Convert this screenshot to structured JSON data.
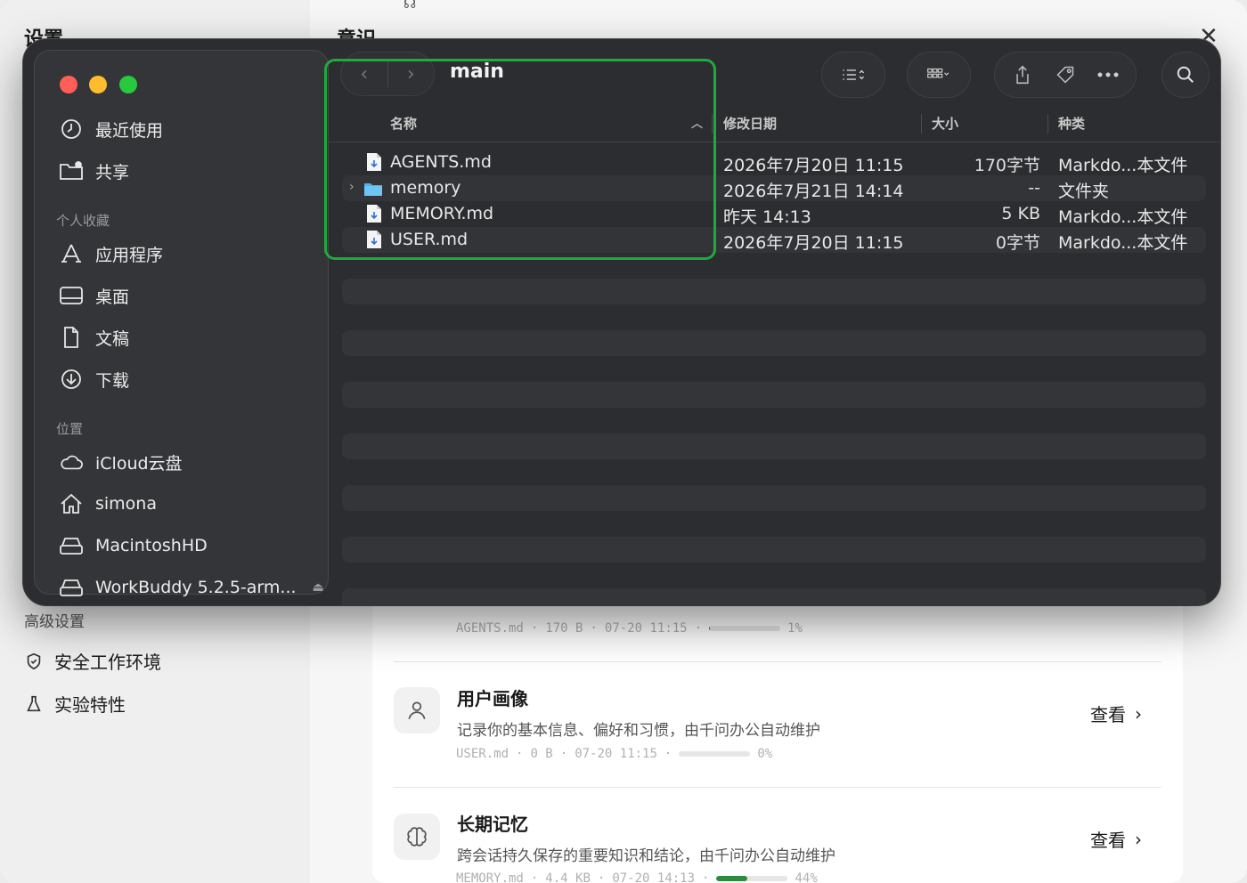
{
  "background": {
    "sidebar_title": "设置",
    "section_title": "意识",
    "close_label": "✕",
    "group_title": "高级设置",
    "nav_items": [
      {
        "label": "安全工作环境",
        "icon": "shield-icon"
      },
      {
        "label": "实验特性",
        "icon": "flask-icon"
      }
    ],
    "memory_items": [
      {
        "title": "",
        "desc": "",
        "file": "AGENTS.md",
        "size": "170 B",
        "date": "07-20 11:15",
        "percent": "1%",
        "fill": 0.01,
        "icon": ""
      },
      {
        "title": "用户画像",
        "desc": "记录你的基本信息、偏好和习惯，由千问办公自动维护",
        "file": "USER.md",
        "size": "0 B",
        "date": "07-20 11:15",
        "percent": "0%",
        "fill": 0.0,
        "icon": "user-icon",
        "view": "查看"
      },
      {
        "title": "长期记忆",
        "desc": "跨会话持久保存的重要知识和结论，由千问办公自动维护",
        "file": "MEMORY.md",
        "size": "4.4 KB",
        "date": "07-20 14:13",
        "percent": "44%",
        "fill": 0.44,
        "icon": "brain-icon",
        "view": "查看"
      }
    ]
  },
  "finder": {
    "path_title": "main",
    "sidebar": {
      "items_top": [
        {
          "label": "最近使用",
          "icon": "clock-icon"
        },
        {
          "label": "共享",
          "icon": "shared-folder-icon"
        }
      ],
      "favorites_heading": "个人收藏",
      "favorites": [
        {
          "label": "应用程序",
          "icon": "apps-icon"
        },
        {
          "label": "桌面",
          "icon": "desktop-icon"
        },
        {
          "label": "文稿",
          "icon": "document-icon"
        },
        {
          "label": "下载",
          "icon": "download-icon"
        }
      ],
      "locations_heading": "位置",
      "locations": [
        {
          "label": "iCloud云盘",
          "icon": "cloud-icon"
        },
        {
          "label": "simona",
          "icon": "home-icon"
        },
        {
          "label": "MacintoshHD",
          "icon": "drive-icon"
        },
        {
          "label": "WorkBuddy 5.2.5-arm...",
          "icon": "drive-icon"
        }
      ],
      "eject": "⏏"
    },
    "columns": {
      "name": "名称",
      "modified": "修改日期",
      "size": "大小",
      "kind": "种类"
    },
    "rows": [
      {
        "name": "AGENTS.md",
        "modified": "2026年7月20日 11:15",
        "size": "170字节",
        "kind": "Markdo...本文件",
        "type": "file"
      },
      {
        "name": "memory",
        "modified": "2026年7月21日 14:14",
        "size": "--",
        "kind": "文件夹",
        "type": "folder"
      },
      {
        "name": "MEMORY.md",
        "modified": "昨天 14:13",
        "size": "5 KB",
        "kind": "Markdo...本文件",
        "type": "file"
      },
      {
        "name": "USER.md",
        "modified": "2026年7月20日 11:15",
        "size": "0字节",
        "kind": "Markdo...本文件",
        "type": "file"
      }
    ],
    "accent": "#1faa3c"
  }
}
